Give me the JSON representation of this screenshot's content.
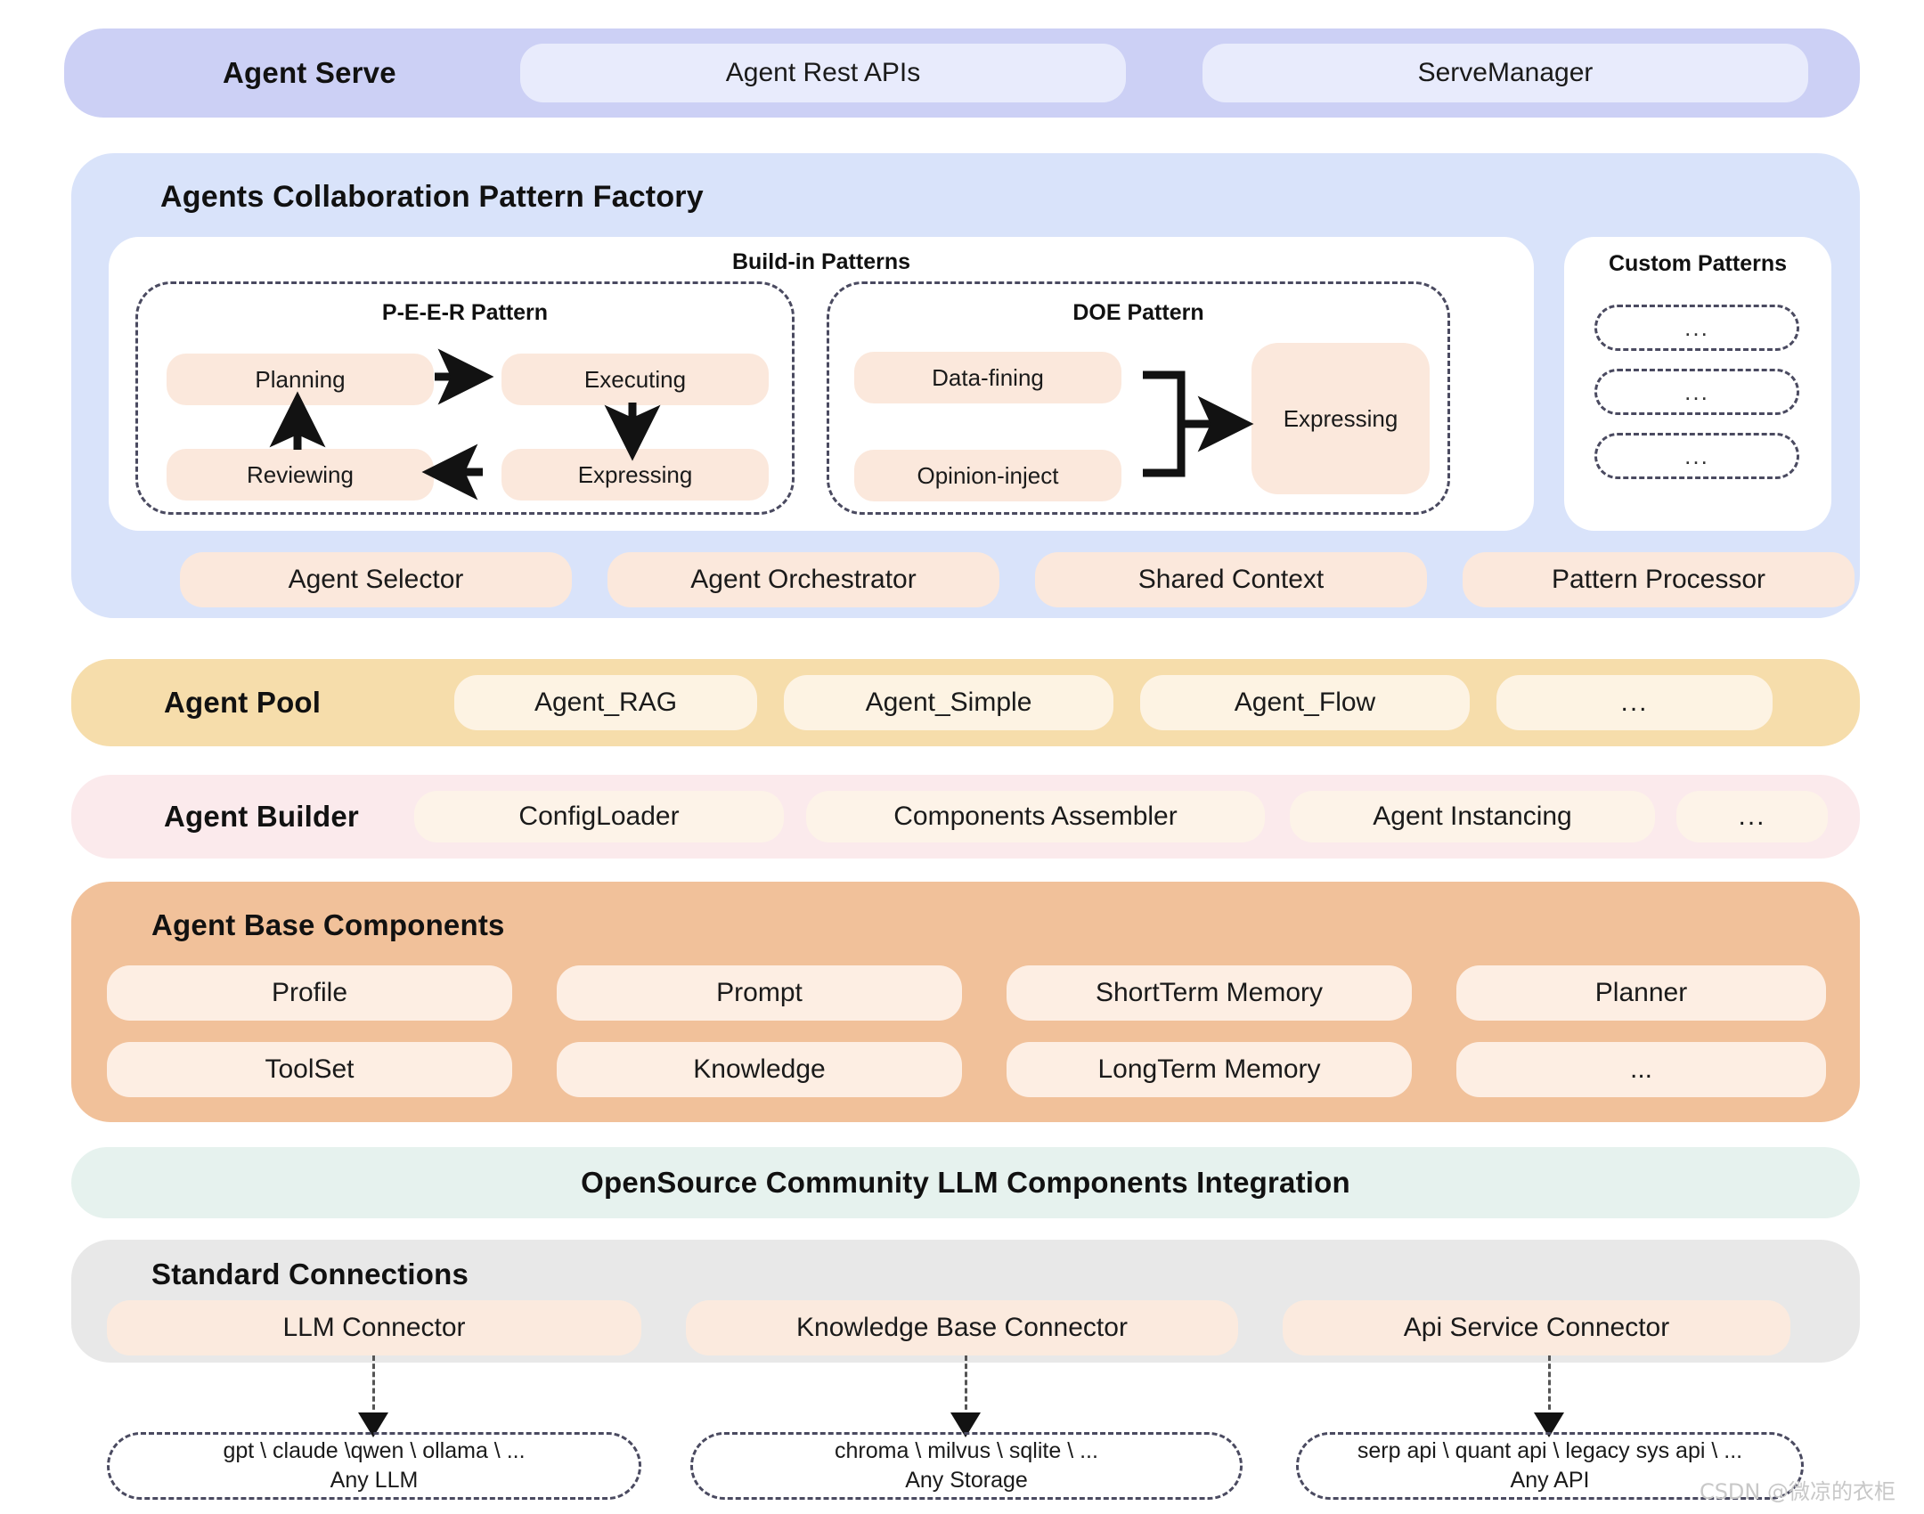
{
  "agent_serve": {
    "title": "Agent Serve",
    "items": [
      "Agent Rest APIs",
      "ServeManager"
    ]
  },
  "factory": {
    "title": "Agents Collaboration Pattern Factory",
    "buildin_title": "Build-in Patterns",
    "peer": {
      "title": "P-E-E-R Pattern",
      "nodes": [
        "Planning",
        "Executing",
        "Reviewing",
        "Expressing"
      ]
    },
    "doe": {
      "title": "DOE Pattern",
      "nodes": [
        "Data-fining",
        "Opinion-inject",
        "Expressing"
      ]
    },
    "custom": {
      "title": "Custom Patterns",
      "slots": [
        "...",
        "...",
        "..."
      ]
    },
    "tools": [
      "Agent Selector",
      "Agent Orchestrator",
      "Shared Context",
      "Pattern Processor"
    ]
  },
  "agent_pool": {
    "title": "Agent Pool",
    "items": [
      "Agent_RAG",
      "Agent_Simple",
      "Agent_Flow",
      "..."
    ]
  },
  "agent_builder": {
    "title": "Agent Builder",
    "items": [
      "ConfigLoader",
      "Components Assembler",
      "Agent Instancing",
      "..."
    ]
  },
  "base_components": {
    "title": "Agent Base Components",
    "row0": [
      "Profile",
      "Prompt",
      "ShortTerm Memory",
      "Planner"
    ],
    "row1": [
      "ToolSet",
      "Knowledge",
      "LongTerm Memory",
      "..."
    ]
  },
  "opensource": {
    "title": "OpenSource Community LLM Components Integration"
  },
  "standard": {
    "title": "Standard Connections",
    "connectors": [
      "LLM Connector",
      "Knowledge Base Connector",
      "Api Service Connector"
    ]
  },
  "backends": [
    {
      "line1": "gpt \\ claude \\qwen \\ ollama \\ ...",
      "line2": "Any LLM"
    },
    {
      "line1": "chroma \\ milvus \\ sqlite \\ ...",
      "line2": "Any Storage"
    },
    {
      "line1": "serp api \\ quant api \\ legacy sys api \\  ...",
      "line2": "Any API"
    }
  ],
  "watermark": "CSDN @微凉的衣柜",
  "colors": {
    "agent_serve_bg": "#ccd0f5",
    "factory_bg": "#d9e3fa",
    "agent_pool_bg": "#f6ddab",
    "agent_builder_bg": "#fbeaec",
    "base_components_bg": "#f1c19a",
    "opensource_bg": "#e6f2ee",
    "standard_bg": "#e8e8e8",
    "node_bg": "#fbe8dc",
    "arrow": "#121212"
  }
}
